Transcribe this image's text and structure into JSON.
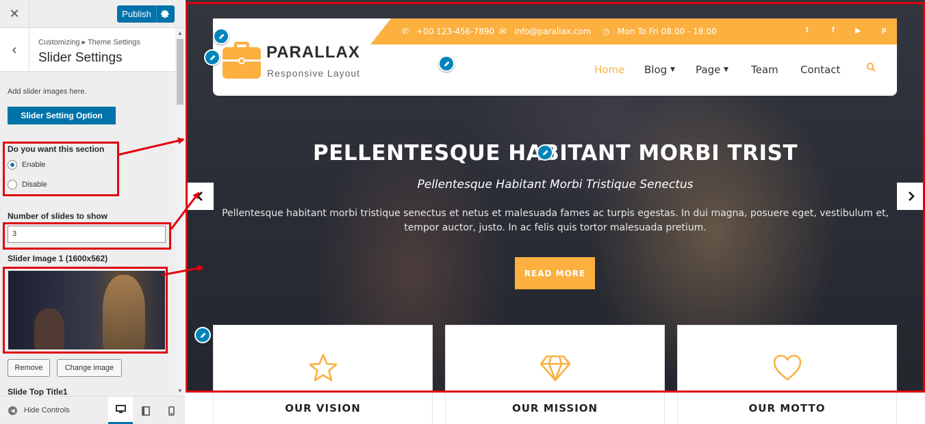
{
  "topbar": {
    "close_icon": "close-icon",
    "publish_label": "Publish",
    "settings_icon": "gear-icon"
  },
  "panel": {
    "breadcrumb": "Customizing ▸ Theme Settings",
    "title": "Slider Settings",
    "description": "Add slider images here.",
    "option_button": "Slider Setting Option"
  },
  "section_toggle": {
    "label": "Do you want this section",
    "options": [
      "Enable",
      "Disable"
    ],
    "selected": "Enable"
  },
  "slides_count": {
    "label": "Number of slides to show",
    "value": "3"
  },
  "slider_image": {
    "label": "Slider Image 1 (1600x562)",
    "remove_label": "Remove",
    "change_label": "Change image"
  },
  "next_field": {
    "label": "Slide Top Title1"
  },
  "footer": {
    "hide_label": "Hide Controls",
    "devices": [
      "desktop-icon",
      "tablet-icon",
      "mobile-icon"
    ]
  },
  "site": {
    "phone": "+00 123-456-7890",
    "email": "info@parallax.com",
    "hours": "Mon To Fri 08:00 - 18:00",
    "logo_name": "PARALLAX",
    "logo_tagline": "Responsive Layout",
    "nav": [
      "Home",
      "Blog",
      "Page",
      "Team",
      "Contact"
    ],
    "accent": "#fbb040"
  },
  "hero": {
    "title": "PELLENTESQUE HABITANT MORBI TRIST",
    "subtitle": "Pellentesque Habitant Morbi Tristique Senectus",
    "body": "Pellentesque habitant morbi tristique senectus et netus et malesuada fames ac turpis egestas. In dui magna, posuere eget, vestibulum et, tempor auctor, justo. In ac felis quis tortor malesuada pretium.",
    "button": "READ MORE"
  },
  "features": [
    {
      "title": "OUR VISION",
      "icon": "star-icon"
    },
    {
      "title": "OUR MISSION",
      "icon": "diamond-icon"
    },
    {
      "title": "OUR MOTTO",
      "icon": "heart-icon"
    }
  ]
}
